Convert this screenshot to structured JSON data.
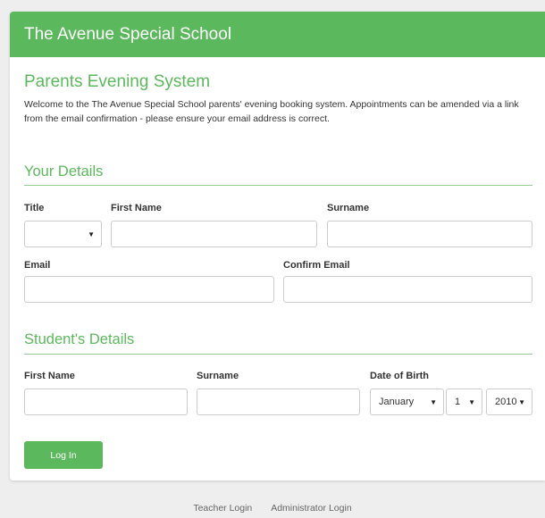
{
  "header": {
    "title": "The Avenue Special School"
  },
  "main": {
    "page_title": "Parents Evening System",
    "intro": "Welcome to the The Avenue Special School parents' evening booking system. Appointments can be amended via a link from the email confirmation - please ensure your email address is correct."
  },
  "your_details": {
    "heading": "Your Details",
    "title_label": "Title",
    "title_value": "",
    "first_name_label": "First Name",
    "surname_label": "Surname",
    "email_label": "Email",
    "confirm_email_label": "Confirm Email"
  },
  "student_details": {
    "heading": "Student's Details",
    "first_name_label": "First Name",
    "surname_label": "Surname",
    "dob_label": "Date of Birth",
    "dob_month": "January",
    "dob_day": "1",
    "dob_year": "2010"
  },
  "actions": {
    "login_label": "Log In"
  },
  "footer": {
    "teacher_login": "Teacher Login",
    "admin_login": "Administrator Login"
  },
  "colors": {
    "accent": "#5cb85c",
    "background": "#eeeeee"
  },
  "icons": {
    "dropdown": "caret-down-icon"
  }
}
